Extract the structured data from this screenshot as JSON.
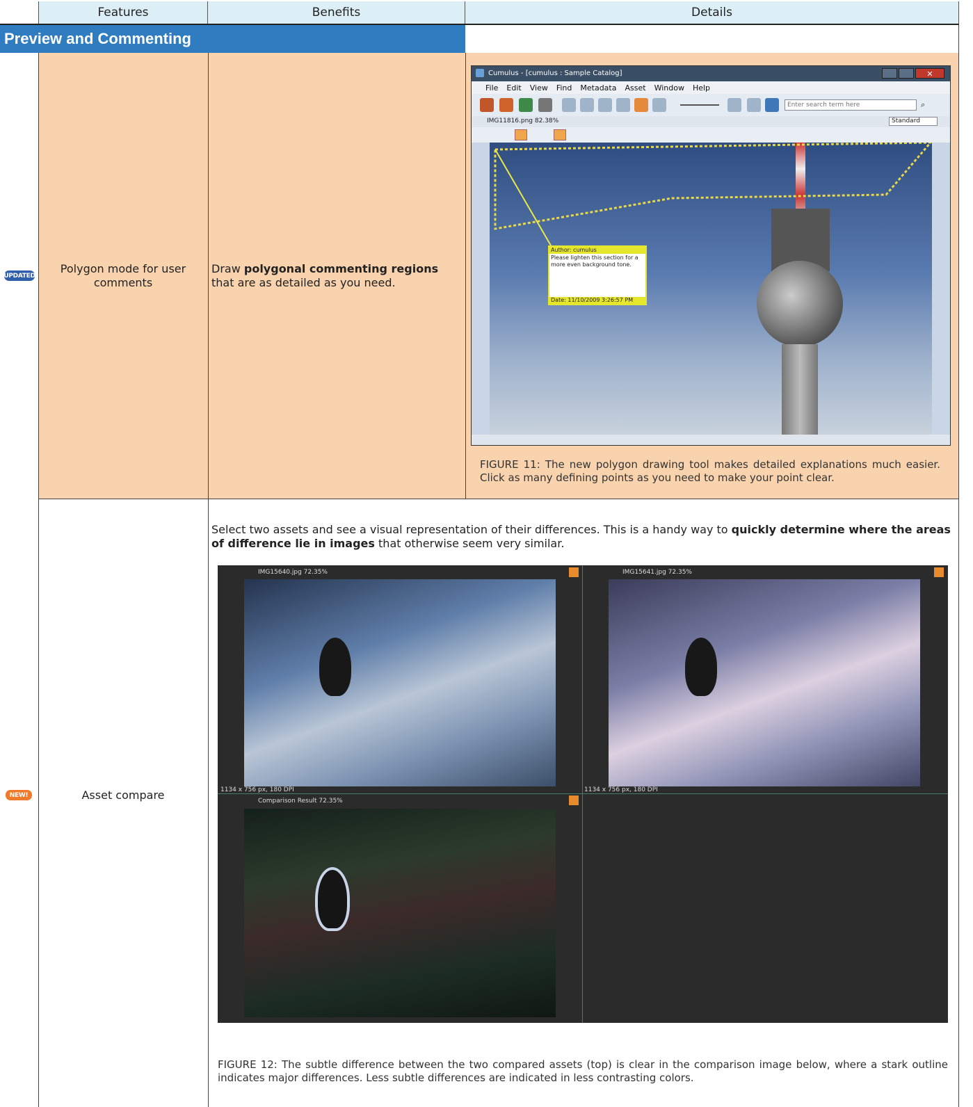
{
  "header": {
    "col_features": "Features",
    "col_benefits": "Benefits",
    "col_details": "Details"
  },
  "section": {
    "title": "Preview and Commenting"
  },
  "rows": [
    {
      "badge": "UPDATED",
      "badge_color": "#2f5faa",
      "feature": "Polygon mode for user comments",
      "benefit_pre": "Draw ",
      "benefit_bold": "polygonal commenting regions",
      "benefit_post": " that are as detailed as you need.",
      "caption": "FIGURE 11: The new polygon drawing tool makes detailed explanations much easier. Click as many defining points as you need to make your point clear.",
      "window": {
        "title": "Cumulus - [cumulus : Sample Catalog]",
        "menu": [
          "File",
          "Edit",
          "View",
          "Find",
          "Metadata",
          "Asset",
          "Window",
          "Help"
        ],
        "search_placeholder": "Enter search term here",
        "file_label": "IMG11816.png  82.38%",
        "view_select": "Standard",
        "note_author": "Author: cumulus",
        "note_text": "Please lighten this section for a more even background tone.",
        "note_date": "Date: 11/10/2009 3:26:57 PM"
      }
    },
    {
      "badge": "NEW!",
      "badge_color": "#f07a2a",
      "feature": "Asset compare",
      "details_pre": "Select two assets and see a visual representation of their differences. This is a handy way to ",
      "details_bold": "quickly determine where the areas of difference lie in images",
      "details_post": " that otherwise seem very similar.",
      "caption": "FIGURE 12: The subtle difference between the two compared assets (top) is clear in the comparison image below, where a stark outline indicates major differences. Less subtle differences are indicated in less contrasting colors.",
      "compare": {
        "left_label": "IMG15640.jpg  72.35%",
        "right_label": "IMG15641.jpg  72.35%",
        "result_label": "Comparison Result  72.35%",
        "left_info": "1134 x 756 px, 180 DPI",
        "right_info": "1134 x 756 px, 180 DPI"
      }
    }
  ]
}
